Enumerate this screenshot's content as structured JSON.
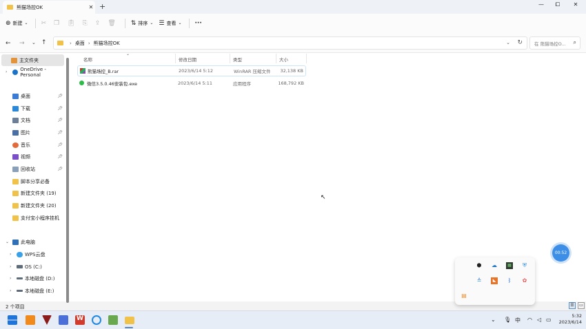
{
  "window": {
    "tab_title": "熊猫场控OK",
    "new_tab": "+",
    "minimize": "—",
    "maximize": "⧠",
    "close": "✕"
  },
  "toolbar": {
    "new_label": "新建",
    "sort_label": "排序",
    "view_label": "查看",
    "more_label": "···"
  },
  "address": {
    "crumbs": [
      "桌面",
      "熊猫场控OK"
    ],
    "search_placeholder": "在 熊猫场控O..."
  },
  "sidebar": {
    "home": "主文件夹",
    "onedrive": "OneDrive - Personal",
    "pinned": [
      {
        "label": "桌面",
        "color": "#3a7bd5"
      },
      {
        "label": "下载",
        "color": "#2b88d8"
      },
      {
        "label": "文档",
        "color": "#6b7f99"
      },
      {
        "label": "图片",
        "color": "#4a6fa5"
      },
      {
        "label": "音乐",
        "color": "#e36a3b"
      },
      {
        "label": "视频",
        "color": "#7a4fc7"
      },
      {
        "label": "回收站",
        "color": "#8aa0b8"
      }
    ],
    "folders": [
      {
        "label": "脚本分享必备"
      },
      {
        "label": "新建文件夹 (19)"
      },
      {
        "label": "新建文件夹 (20)"
      },
      {
        "label": "支付宝小程序挂机"
      }
    ],
    "thispc": "此电脑",
    "drives": [
      {
        "label": "WPS云盘"
      },
      {
        "label": "OS (C:)"
      },
      {
        "label": "本地磁盘 (D:)"
      },
      {
        "label": "本地磁盘 (E:)"
      }
    ]
  },
  "columns": {
    "name": "名称",
    "date": "修改日期",
    "type": "类型",
    "size": "大小"
  },
  "files": [
    {
      "name": "熊猫场控_B.rar",
      "date": "2023/6/14 5:12",
      "type": "WinRAR 压缩文件",
      "size": "32,138 KB"
    },
    {
      "name": "微信3.5.0.46安装包.exe",
      "date": "2023/6/14 5:11",
      "type": "应用程序",
      "size": "168,792 KB"
    }
  ],
  "status": {
    "count": "2 个项目"
  },
  "timer": "00:52",
  "clock": {
    "time": "5:32",
    "date": "2023/6/14"
  },
  "tray": {
    "ime": "中"
  },
  "colors": {
    "accent": "#3c8ee6",
    "folder": "#f0c24a"
  }
}
